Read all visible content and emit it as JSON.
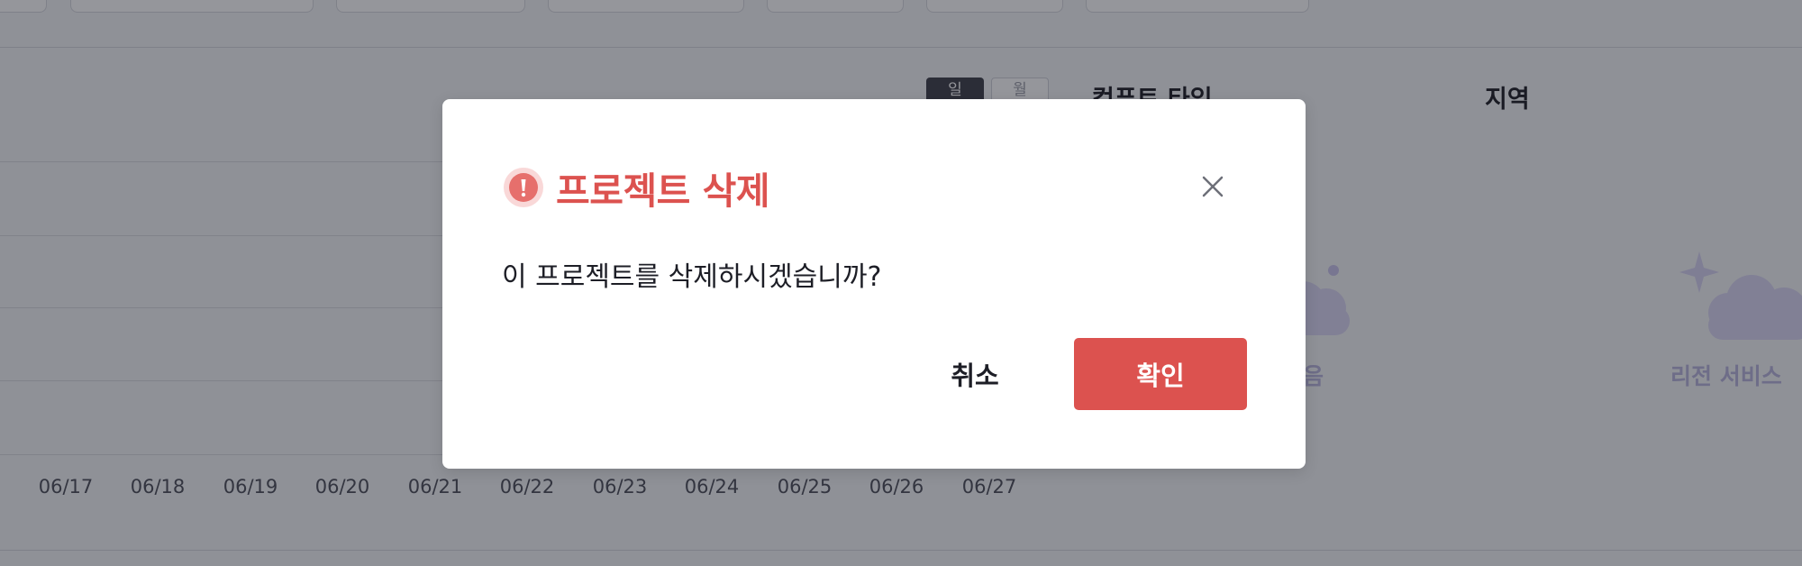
{
  "colors": {
    "accent_danger": "#dc524f",
    "overlay": "rgba(24,26,36,0.46)",
    "empty_text": "#b7b3dc"
  },
  "period_toggle": {
    "day_label": "일",
    "month_label": "월",
    "selected": "일"
  },
  "sections": {
    "compute_type_title": "컴퓨트 타입",
    "region_title": "지역"
  },
  "chart": {
    "x_ticks": [
      "06/17",
      "06/18",
      "06/19",
      "06/20",
      "06/21",
      "06/22",
      "06/23",
      "06/24",
      "06/25",
      "06/26",
      "06/27"
    ]
  },
  "empty_states": {
    "compute_partial_text": "음",
    "region_partial_text": "리전 서비스 "
  },
  "modal": {
    "icon": "warning-icon",
    "title": "프로젝트 삭제",
    "message": "이 프로젝트를 삭제하시겠습니까?",
    "cancel_label": "취소",
    "confirm_label": "확인",
    "close_icon": "close-icon"
  }
}
